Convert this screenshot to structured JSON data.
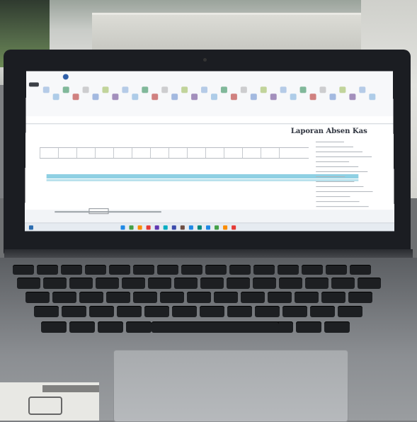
{
  "scene": {
    "description_type": "photo-of-laptop-screen",
    "screen": {
      "document_title": "Laporan Absen Kas",
      "app": "spreadsheet"
    },
    "colors": {
      "highlight_row": "#8fd0e3",
      "laptop_body": "#1b1d22",
      "deck": "#8b8e92"
    }
  }
}
